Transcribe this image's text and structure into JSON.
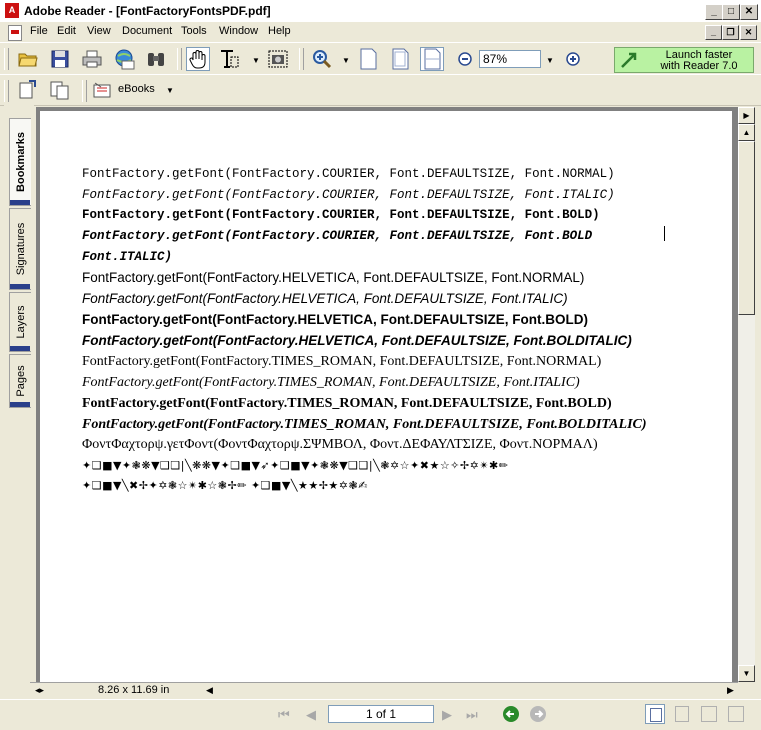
{
  "window": {
    "title": "Adobe Reader - [FontFactoryFontsPDF.pdf]",
    "app_icon_label": "A"
  },
  "menu": {
    "items": [
      "File",
      "Edit",
      "View",
      "Document",
      "Tools",
      "Window",
      "Help"
    ]
  },
  "toolbar": {
    "zoom_value": "87%",
    "launch_line1": "Launch faster",
    "launch_line2": "with Reader 7.0",
    "ebooks_label": "eBooks"
  },
  "nav_tabs": [
    "Bookmarks",
    "Signatures",
    "Layers",
    "Pages"
  ],
  "document": {
    "lines": [
      "FontFactory.getFont(FontFactory.COURIER, Font.DEFAULTSIZE, Font.NORMAL)",
      "FontFactory.getFont(FontFactory.COURIER, Font.DEFAULTSIZE, Font.ITALIC)",
      "FontFactory.getFont(FontFactory.COURIER, Font.DEFAULTSIZE, Font.BOLD)",
      "FontFactory.getFont(FontFactory.COURIER, Font.DEFAULTSIZE, Font.BOLD",
      "Font.ITALIC)",
      "FontFactory.getFont(FontFactory.HELVETICA, Font.DEFAULTSIZE, Font.NORMAL)",
      "FontFactory.getFont(FontFactory.HELVETICA, Font.DEFAULTSIZE, Font.ITALIC)",
      "FontFactory.getFont(FontFactory.HELVETICA, Font.DEFAULTSIZE, Font.BOLD)",
      "FontFactory.getFont(FontFactory.HELVETICA, Font.DEFAULTSIZE, Font.BOLDITALIC)",
      "FontFactory.getFont(FontFactory.TIMES_ROMAN, Font.DEFAULTSIZE, Font.NORMAL)",
      "FontFactory.getFont(FontFactory.TIMES_ROMAN, Font.DEFAULTSIZE, Font.ITALIC)",
      "FontFactory.getFont(FontFactory.TIMES_ROMAN, Font.DEFAULTSIZE, Font.BOLD)",
      "FontFactory.getFont(FontFactory.TIMES_ROMAN, Font.DEFAULTSIZE, Font.BOLDITALIC)",
      "ΦοντΦαχτορψ.γετΦοντ(ΦοντΦαχτορψ.ΣΨΜΒΟΛ, Φοντ.ΔΕΦΑΥΛΤΣΙΖΕ, Φοντ.ΝΟΡΜΑΛ)",
      "✦❑■▼✦❃❋▼❑❑|╲❋❋▼✦❑■▼➶✦❑■▼✦❃❋▼❑❑|╲❃✡☆✦✖★☆✧✢✡✴✱✏",
      "✦❑■▼╲✖✢✦✡❃☆✴✱☆❃✢✏ ✦❑■▼╲★★✢★✡❃✍"
    ]
  },
  "status": {
    "page_size": "8.26 x 11.69 in",
    "page_indicator": "1 of 1"
  }
}
